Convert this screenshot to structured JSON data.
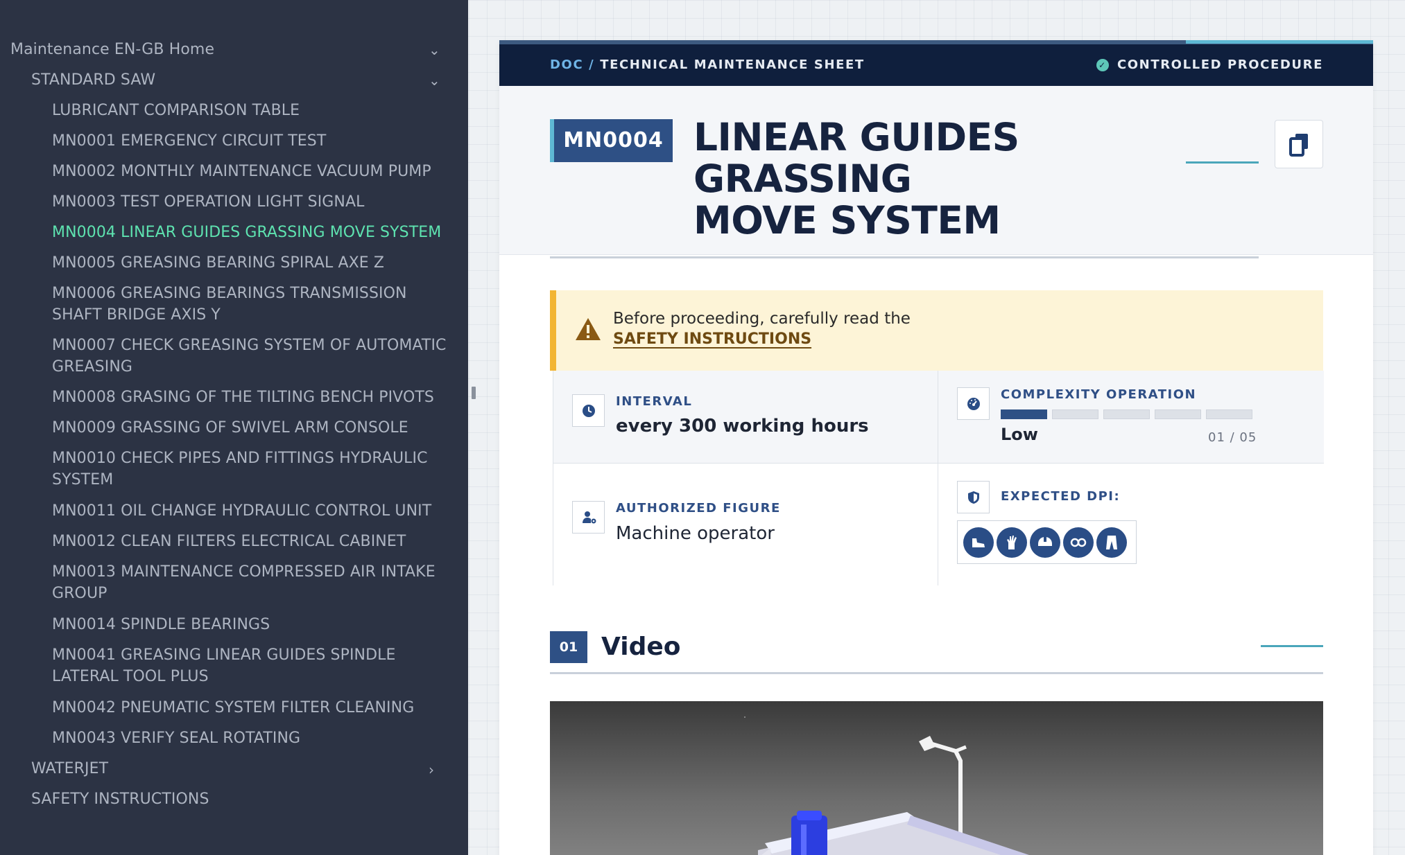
{
  "sidebar": {
    "home": "Maintenance EN-GB Home",
    "standard_saw": "STANDARD SAW",
    "items": [
      "LUBRICANT COMPARISON TABLE",
      "MN0001 EMERGENCY CIRCUIT TEST",
      "MN0002 MONTHLY MAINTENANCE VACUUM PUMP",
      "MN0003 TEST OPERATION LIGHT SIGNAL",
      "MN0004 LINEAR GUIDES GRASSING MOVE SYSTEM",
      "MN0005 GREASING BEARING SPIRAL AXE Z",
      "MN0006 GREASING BEARINGS TRANSMISSION SHAFT BRIDGE AXIS Y",
      "MN0007 CHECK GREASING SYSTEM OF AUTOMATIC GREASING",
      "MN0008 GRASING OF THE TILTING BENCH PIVOTS",
      "MN0009 GRASSING OF SWIVEL ARM CONSOLE",
      "MN0010 CHECK PIPES AND FITTINGS HYDRAULIC SYSTEM",
      "MN0011 OIL CHANGE HYDRAULIC CONTROL UNIT",
      "MN0012 CLEAN FILTERS ELECTRICAL CABINET",
      "MN0013 MAINTENANCE COMPRESSED AIR INTAKE GROUP",
      "MN0014 SPINDLE BEARINGS",
      "MN0041 GREASING LINEAR GUIDES SPINDLE LATERAL TOOL PLUS",
      "MN0042 PNEUMATIC SYSTEM FILTER CLEANING",
      "MN0043 VERIFY SEAL ROTATING"
    ],
    "active_index": 4,
    "waterjet": "WATERJET",
    "safety": "SAFETY INSTRUCTIONS",
    "chevron_down": "⌄",
    "chevron_right": "›"
  },
  "doc": {
    "crumb_doc": "DOC",
    "crumb_sep": "/",
    "crumb_type": "TECHNICAL MAINTENANCE SHEET",
    "controlled": "CONTROLLED PROCEDURE",
    "code": "MN0004",
    "title_line1": "LINEAR GUIDES GRASSING",
    "title_line2": "MOVE SYSTEM"
  },
  "warning": {
    "text": "Before proceeding, carefully read the",
    "link": "SAFETY INSTRUCTIONS"
  },
  "info": {
    "interval_label": "INTERVAL",
    "interval_value": "every 300 working hours",
    "complexity_label": "COMPLEXITY OPERATION",
    "complexity_value": "Low",
    "complexity_level": 1,
    "complexity_max": 5,
    "complexity_count": "01 / 05",
    "figure_label": "AUTHORIZED FIGURE",
    "figure_value": "Machine operator",
    "dpi_label": "EXPECTED DPI:",
    "dpi_icons": [
      "safety-shoes-icon",
      "gloves-icon",
      "helmet-icon",
      "goggles-icon",
      "overalls-icon"
    ]
  },
  "section": {
    "number": "01",
    "title": "Video"
  },
  "colors": {
    "sidebar_bg": "#2c3344",
    "active_item": "#5ee3b0",
    "topbar": "#0f1f3d",
    "accent_blue": "#2e5085",
    "accent_teal": "#4aa6ba",
    "warning_bg": "#fdf4d7",
    "warning_border": "#f2b533"
  }
}
